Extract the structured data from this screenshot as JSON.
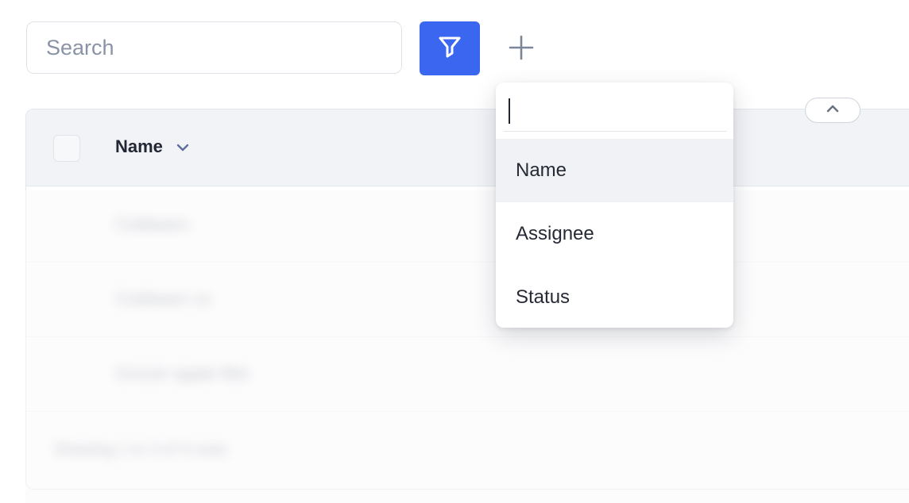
{
  "toolbar": {
    "search_placeholder": "Search",
    "filter_icon": "funnel-icon",
    "add_icon": "plus-icon"
  },
  "table": {
    "header": {
      "name_label": "Name",
      "sort_icon": "chevron-down-icon",
      "collapse_icon": "chevron-up-icon"
    },
    "rows": [
      {
        "name": "Coldwarn"
      },
      {
        "name": "Coldwarn xx"
      },
      {
        "name": "Grocer apple fiter"
      }
    ],
    "footer": "Showing 1 to 3 of 3 rows"
  },
  "dropdown": {
    "search_value": "",
    "items": [
      {
        "label": "Name"
      },
      {
        "label": "Assignee"
      },
      {
        "label": "Status"
      }
    ]
  },
  "colors": {
    "accent": "#3a66f0",
    "header_bg": "#f1f3f7",
    "active_item_bg": "#f1f2f5"
  }
}
